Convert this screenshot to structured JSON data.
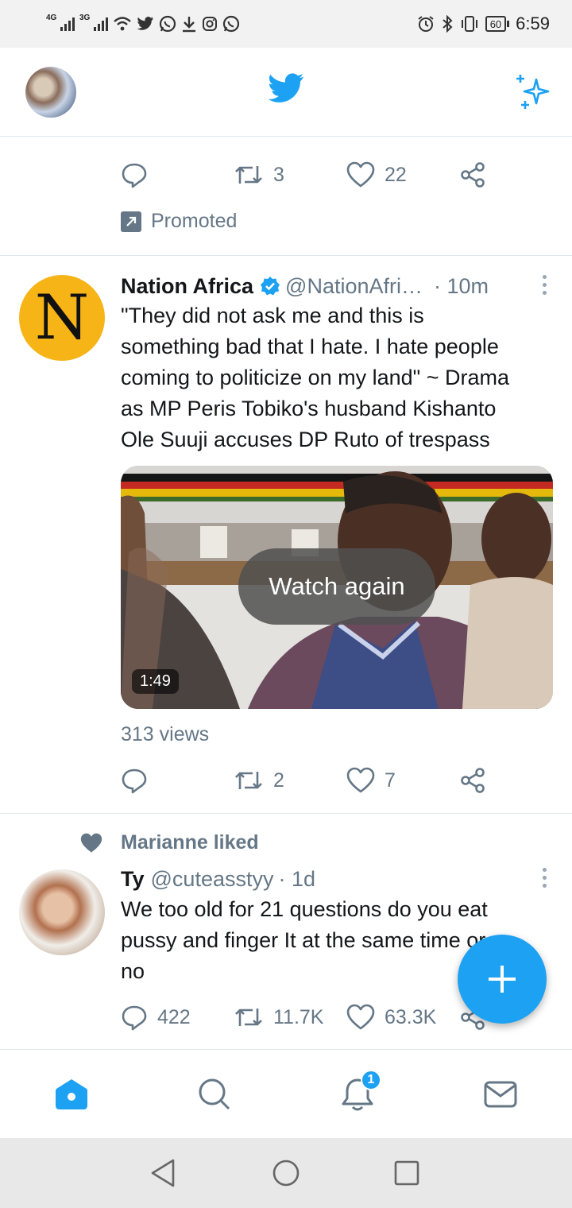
{
  "status_bar": {
    "network_1": "4G",
    "network_2": "3G",
    "battery": "60",
    "time": "6:59"
  },
  "header": {
    "logo_icon": "twitter-bird-icon",
    "sparkle_icon": "sparkle-icon",
    "accent_color": "#1da1f2"
  },
  "promo_tweet": {
    "retweets": "3",
    "likes": "22",
    "promoted_label": "Promoted"
  },
  "tweet1": {
    "name": "Nation Africa",
    "handle": "@NationAfri…",
    "time": "· 10m",
    "avatar_letter": "N",
    "text_lines": [
      "\"They did not ask me and this is",
      "something bad that I hate. I hate people",
      "coming to politicize on my land\" ~ Drama",
      "as MP Peris Tobiko's husband Kishanto",
      "Ole Suuji accuses DP Ruto of trespass"
    ],
    "video": {
      "watch_again": "Watch again",
      "duration": "1:49"
    },
    "views": "313 views",
    "retweets": "2",
    "likes": "7"
  },
  "tweet2": {
    "liked_by": "Marianne liked",
    "name": "Ty",
    "handle": "@cuteasstyy",
    "time": "· 1d",
    "text_lines": [
      "We too old for 21 questions do you eat",
      "pussy and finger It at the same time or",
      "no"
    ],
    "replies": "422",
    "retweets": "11.7K",
    "likes": "63.3K"
  },
  "bottom_nav": {
    "notifications_badge": "1"
  }
}
